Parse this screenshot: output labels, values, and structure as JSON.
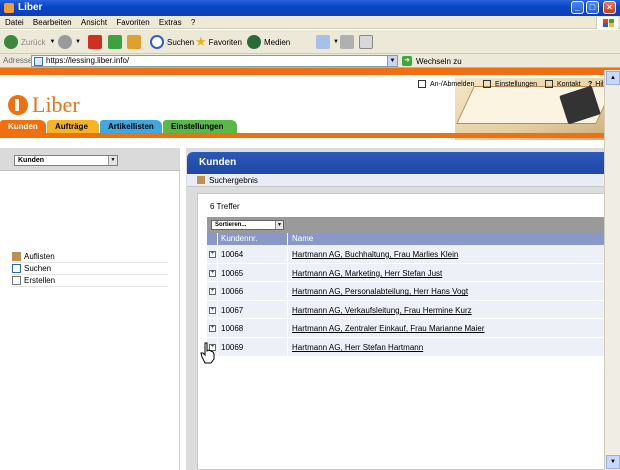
{
  "window": {
    "title": "Liber"
  },
  "menu": [
    "Datei",
    "Bearbeiten",
    "Ansicht",
    "Favoriten",
    "Extras",
    "?"
  ],
  "toolbar": {
    "back": "Zurück",
    "search": "Suchen",
    "favorites": "Favoriten",
    "media": "Medien"
  },
  "address": {
    "label": "Adresse",
    "url": "https://lessing.liber.info/",
    "go": "Wechseln zu"
  },
  "utility": {
    "login": "An-/Abmelden",
    "settings": "Einstellungen",
    "contact": "Kontakt",
    "help": "Hilfe"
  },
  "logo": {
    "text": "Liber"
  },
  "tabs": [
    "Kunden",
    "Aufträge",
    "Artikellisten",
    "Einstellungen"
  ],
  "sidebar": {
    "select": "Kunden",
    "items": [
      "Auflisten",
      "Suchen",
      "Erstellen"
    ]
  },
  "main": {
    "title": "Kunden",
    "crumb": "Suchergebnis",
    "hits": "6 Treffer",
    "sort": "Sortieren...",
    "columns": [
      "Kundennr.",
      "Name"
    ],
    "rows": [
      {
        "id": "10064",
        "name": "Hartmann AG, Buchhaltung, Frau Marlies Klein"
      },
      {
        "id": "10065",
        "name": "Hartmann AG, Marketing, Herr Stefan Just"
      },
      {
        "id": "10066",
        "name": "Hartmann AG, Personalabteilung, Herr Hans Vogt"
      },
      {
        "id": "10067",
        "name": "Hartmann AG, Verkaufsleitung, Frau Hermine Kurz"
      },
      {
        "id": "10068",
        "name": "Hartmann AG, Zentraler Einkauf, Frau Marianne Maier"
      },
      {
        "id": "10069",
        "name": "Hartmann AG, Herr Stefan Hartmann"
      }
    ]
  }
}
